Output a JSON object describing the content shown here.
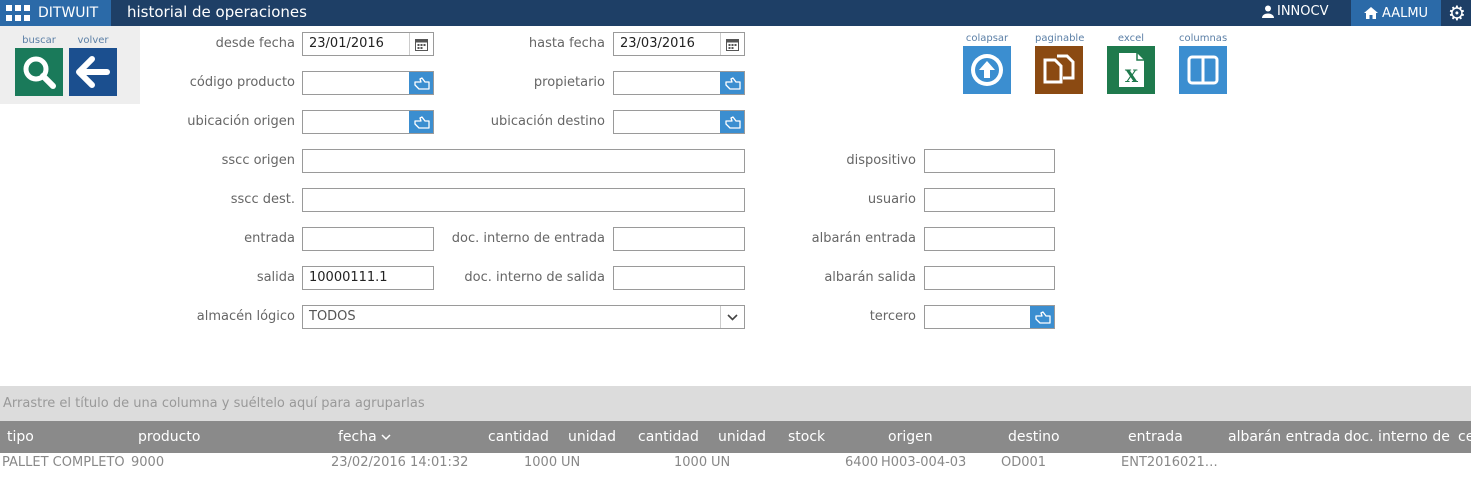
{
  "app": {
    "brand": "DITWUIT",
    "title": "historial de operaciones",
    "user": "INNOCV",
    "tenant": "AALMU"
  },
  "tools": {
    "buscar": "buscar",
    "volver": "volver",
    "colapsar": "colapsar",
    "paginable": "paginable",
    "excel": "excel",
    "columnas": "columnas"
  },
  "form": {
    "desde_fecha": {
      "label": "desde fecha",
      "value": "23/01/2016"
    },
    "hasta_fecha": {
      "label": "hasta fecha",
      "value": "23/03/2016"
    },
    "codigo_producto": {
      "label": "código producto",
      "value": ""
    },
    "propietario": {
      "label": "propietario",
      "value": ""
    },
    "ubicacion_origen": {
      "label": "ubicación origen",
      "value": ""
    },
    "ubicacion_destino": {
      "label": "ubicación destino",
      "value": ""
    },
    "sscc_origen": {
      "label": "sscc origen",
      "value": ""
    },
    "dispositivo": {
      "label": "dispositivo",
      "value": ""
    },
    "sscc_dest": {
      "label": "sscc dest.",
      "value": ""
    },
    "usuario": {
      "label": "usuario",
      "value": ""
    },
    "entrada": {
      "label": "entrada",
      "value": ""
    },
    "doc_interno_entrada": {
      "label": "doc. interno de entrada",
      "value": ""
    },
    "albaran_entrada": {
      "label": "albarán entrada",
      "value": ""
    },
    "salida": {
      "label": "salida",
      "value": "10000111.1"
    },
    "doc_interno_salida": {
      "label": "doc. interno de salida",
      "value": ""
    },
    "albaran_salida": {
      "label": "albarán salida",
      "value": ""
    },
    "almacen_logico": {
      "label": "almacén lógico",
      "value": "TODOS"
    },
    "tercero": {
      "label": "tercero",
      "value": ""
    }
  },
  "grid": {
    "group_hint": "Arrastre el título de una columna y suéltelo aquí para agruparlas",
    "columns": [
      "tipo",
      "producto",
      "fecha",
      "cantidad",
      "unidad",
      "cantidad",
      "unidad",
      "stock",
      "origen",
      "destino",
      "entrada",
      "albarán entrada",
      "doc. interno de e",
      "ce"
    ],
    "rows": [
      [
        "PALLET COMPLETO",
        "9000",
        "23/02/2016 14:01:32",
        "1000",
        "UN",
        "1000",
        "UN",
        "6400",
        "H003-004-03",
        "OD001",
        "ENT2016021…"
      ]
    ]
  },
  "colors": {
    "topbar": "#1e3f66",
    "accent": "#2b6aa8",
    "search_btn": "#1a7a5a",
    "back_btn": "#1b4f8f",
    "collapse_btn": "#3b8ed0",
    "paginable_btn": "#8b4a12",
    "excel_btn": "#1f7a4d",
    "columns_btn": "#3b8ed0"
  }
}
